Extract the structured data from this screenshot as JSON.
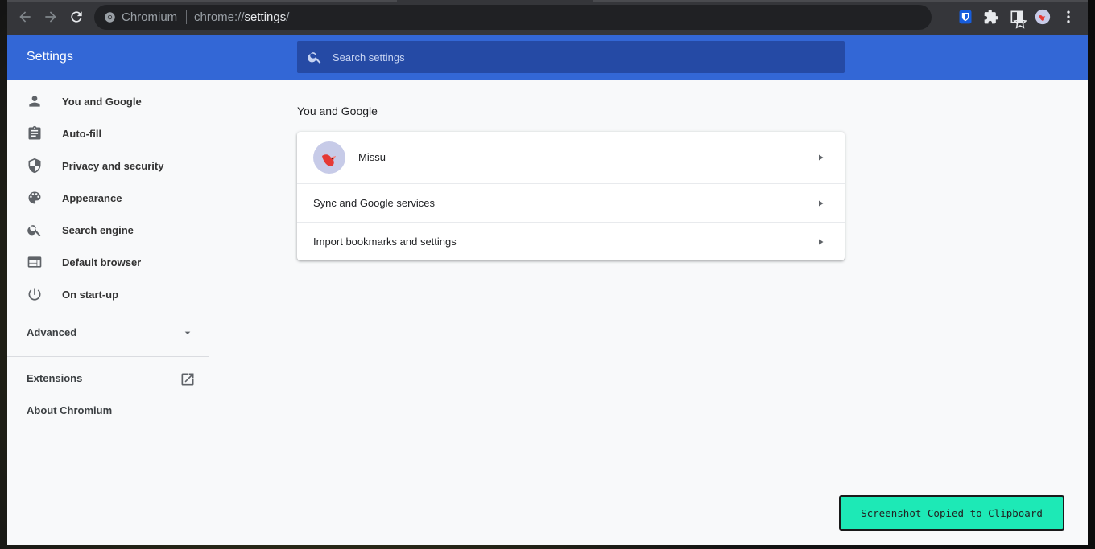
{
  "browser": {
    "site_name": "Chromium",
    "url_scheme": "chrome://",
    "url_host": "settings",
    "url_path": "/"
  },
  "settings": {
    "title": "Settings",
    "search_placeholder": "Search settings"
  },
  "sidebar": {
    "items": [
      {
        "label": "You and Google",
        "icon": "person-icon"
      },
      {
        "label": "Auto-fill",
        "icon": "clipboard-icon"
      },
      {
        "label": "Privacy and security",
        "icon": "shield-icon"
      },
      {
        "label": "Appearance",
        "icon": "palette-icon"
      },
      {
        "label": "Search engine",
        "icon": "search-icon"
      },
      {
        "label": "Default browser",
        "icon": "browser-window-icon"
      },
      {
        "label": "On start-up",
        "icon": "power-icon"
      }
    ],
    "advanced": "Advanced",
    "extensions": "Extensions",
    "about": "About Chromium"
  },
  "main": {
    "section_title": "You and Google",
    "profile_name": "Missu",
    "rows": [
      "Sync and Google services",
      "Import bookmarks and settings"
    ]
  },
  "toast": {
    "message": "Screenshot Copied to Clipboard"
  },
  "colors": {
    "header_blue": "#3367d6",
    "search_blue": "#254aa5",
    "toolbar_dark": "#35363a",
    "toast_green": "#1de9b6"
  }
}
